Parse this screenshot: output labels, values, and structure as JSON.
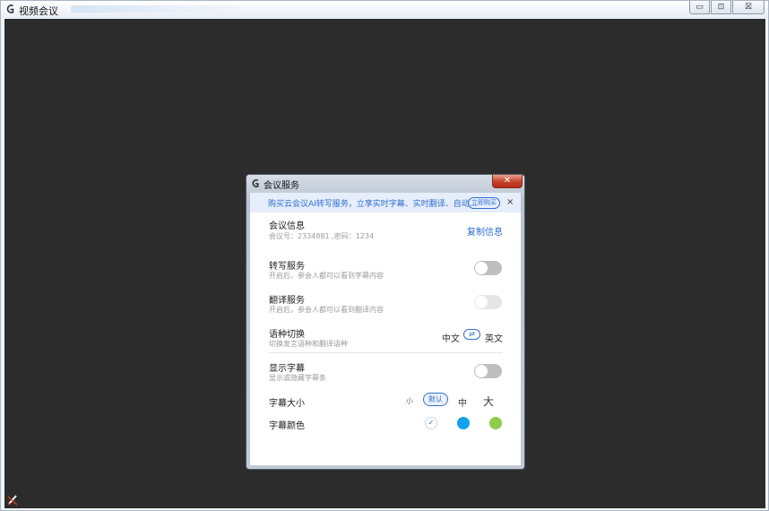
{
  "window": {
    "title": "视频会议",
    "buttons": {
      "minimize": "▭",
      "maximize": "⊡",
      "close": "⛝"
    }
  },
  "dialog": {
    "title": "会议服务",
    "close_label": "✕",
    "banner": {
      "text": "购买云会议AI转写服务，立享实时字幕、实时翻译、自动...",
      "button": "立即购买",
      "close": "×"
    },
    "meeting_info": {
      "title": "会议信息",
      "detail": "会议号：2334881 ,密码：1234",
      "copy_label": "复制信息"
    },
    "transcription": {
      "title": "转写服务",
      "description": "开启后，参会人都可以看到字幕内容",
      "enabled": false
    },
    "translation": {
      "title": "翻译服务",
      "description": "开启后，参会人都可以看到翻译内容",
      "enabled": false,
      "disabled": true
    },
    "language_switch": {
      "title": "语种切换",
      "description": "切换发言语种和翻译语种",
      "source": "中文",
      "swap_icon": "⇄",
      "target": "英文"
    },
    "show_subtitles": {
      "title": "显示字幕",
      "description": "显示或隐藏字幕条",
      "enabled": false
    },
    "subtitle_size": {
      "title": "字幕大小",
      "options": [
        "小",
        "默认",
        "中",
        "大"
      ],
      "selected": "默认"
    },
    "subtitle_color": {
      "title": "字幕颜色",
      "options": [
        {
          "color": "#ffffff",
          "selected": true,
          "mark": "✓"
        },
        {
          "color": "#12a3ee",
          "selected": false
        },
        {
          "color": "#8ccd4a",
          "selected": false
        }
      ]
    }
  },
  "colors": {
    "accent": "#2f6fd0",
    "video_background": "#2c2c2c",
    "toggle_off": "#bfbfbf"
  }
}
